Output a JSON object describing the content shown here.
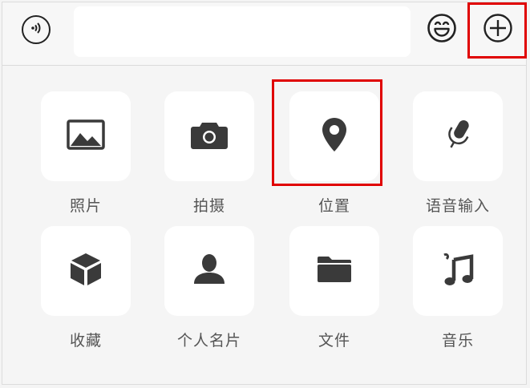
{
  "input_bar": {
    "voice_icon": "voice-input-icon",
    "text_value": "",
    "emoji_icon": "smiley-icon",
    "more_icon": "plus-circle-icon"
  },
  "panel": {
    "row1": [
      {
        "label": "照片",
        "icon": "photo-icon"
      },
      {
        "label": "拍摄",
        "icon": "camera-icon"
      },
      {
        "label": "位置",
        "icon": "location-pin-icon"
      },
      {
        "label": "语音输入",
        "icon": "microphone-icon"
      }
    ],
    "row2": [
      {
        "label": "收藏",
        "icon": "cube-icon"
      },
      {
        "label": "个人名片",
        "icon": "person-icon"
      },
      {
        "label": "文件",
        "icon": "folder-icon"
      },
      {
        "label": "音乐",
        "icon": "music-note-icon"
      }
    ]
  },
  "colors": {
    "highlight": "#e00000",
    "icon": "#3a3a3a",
    "tile_bg": "#ffffff",
    "panel_bg": "#f5f5f5"
  }
}
